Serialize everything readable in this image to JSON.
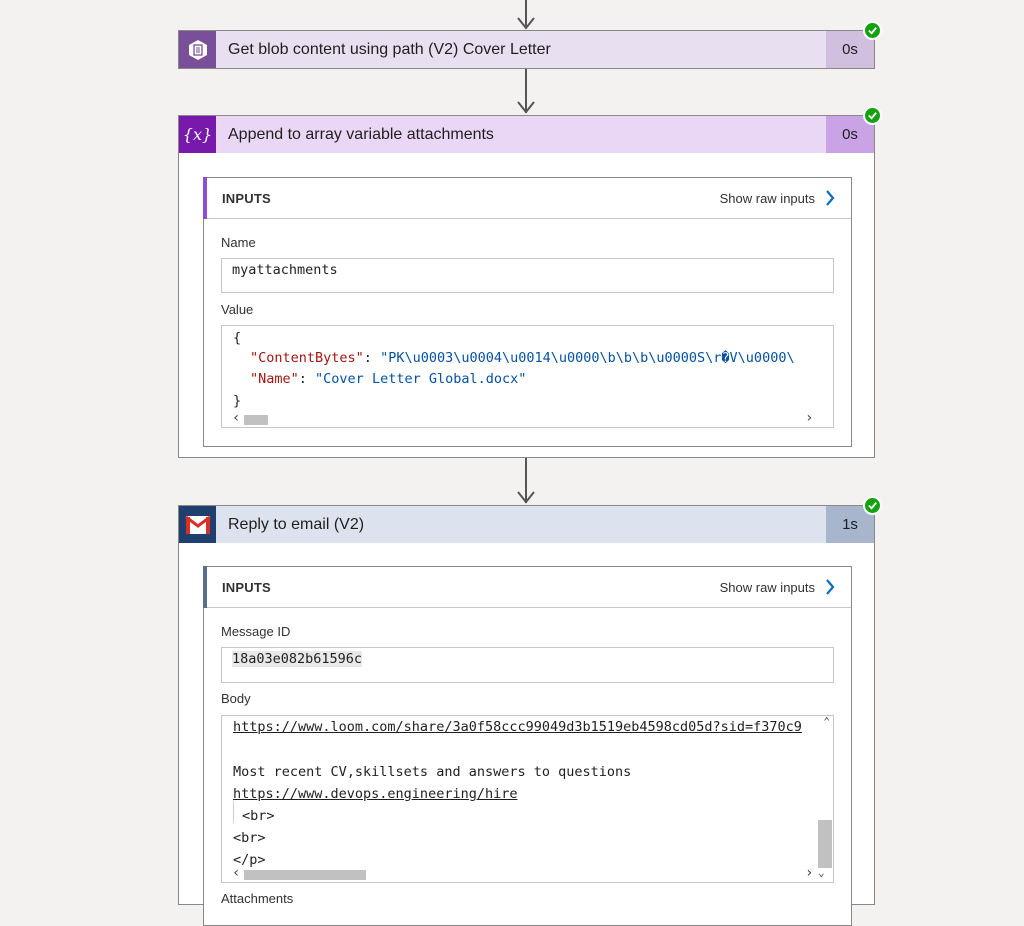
{
  "steps": {
    "blob": {
      "title": "Get blob content using path (V2) Cover Letter",
      "duration": "0s",
      "header_color": "#e8e0f0",
      "icon_bg": "#7a4f9a",
      "duration_bg": "#d0bfdf",
      "icon": "blob-storage-icon"
    },
    "append": {
      "title": "Append to array variable attachments",
      "duration": "0s",
      "header_color": "#ead7f5",
      "icon_bg": "#7719aa",
      "duration_bg": "#c9a3e6",
      "icon": "variable-icon",
      "icon_text": "{x}",
      "inputs_label": "INPUTS",
      "show_raw": "Show raw inputs",
      "name_label": "Name",
      "name_value": "myattachments",
      "value_label": "Value",
      "value_lines": {
        "open": "{",
        "k1": "\"ContentBytes\"",
        "v1": "\"PK\\u0003\\u0004\\u0014\\u0000\\b\\b\\b\\u0000S\\r�V\\u0000\\",
        "k2": "\"Name\"",
        "v2": "\"Cover Letter Global.docx\"",
        "close": "}"
      }
    },
    "reply": {
      "title": "Reply to email (V2)",
      "duration": "1s",
      "header_color": "#dde3ee",
      "icon_bg": "#1f3f6e",
      "duration_bg": "#a7b6cc",
      "icon": "gmail-icon",
      "inputs_label": "INPUTS",
      "show_raw": "Show raw inputs",
      "message_id_label": "Message ID",
      "message_id_value": "18a03e082b61596c",
      "body_label": "Body",
      "body_lines": {
        "l1": "https://www.loom.com/share/3a0f58ccc99049d3b1519eb4598cd05d?sid=f370c9",
        "l2": "Most recent CV,skillsets and answers to questions",
        "l3": "https://www.devops.engineering/hire",
        "l4": "<br>",
        "l5": "<br>",
        "l6": "</p>"
      },
      "attachments_label": "Attachments"
    }
  },
  "colors": {
    "success": "#13a10e",
    "append_accent": "#8c4fd1",
    "reply_accent": "#5b6e8c",
    "chevron": "#0f6cbd"
  }
}
